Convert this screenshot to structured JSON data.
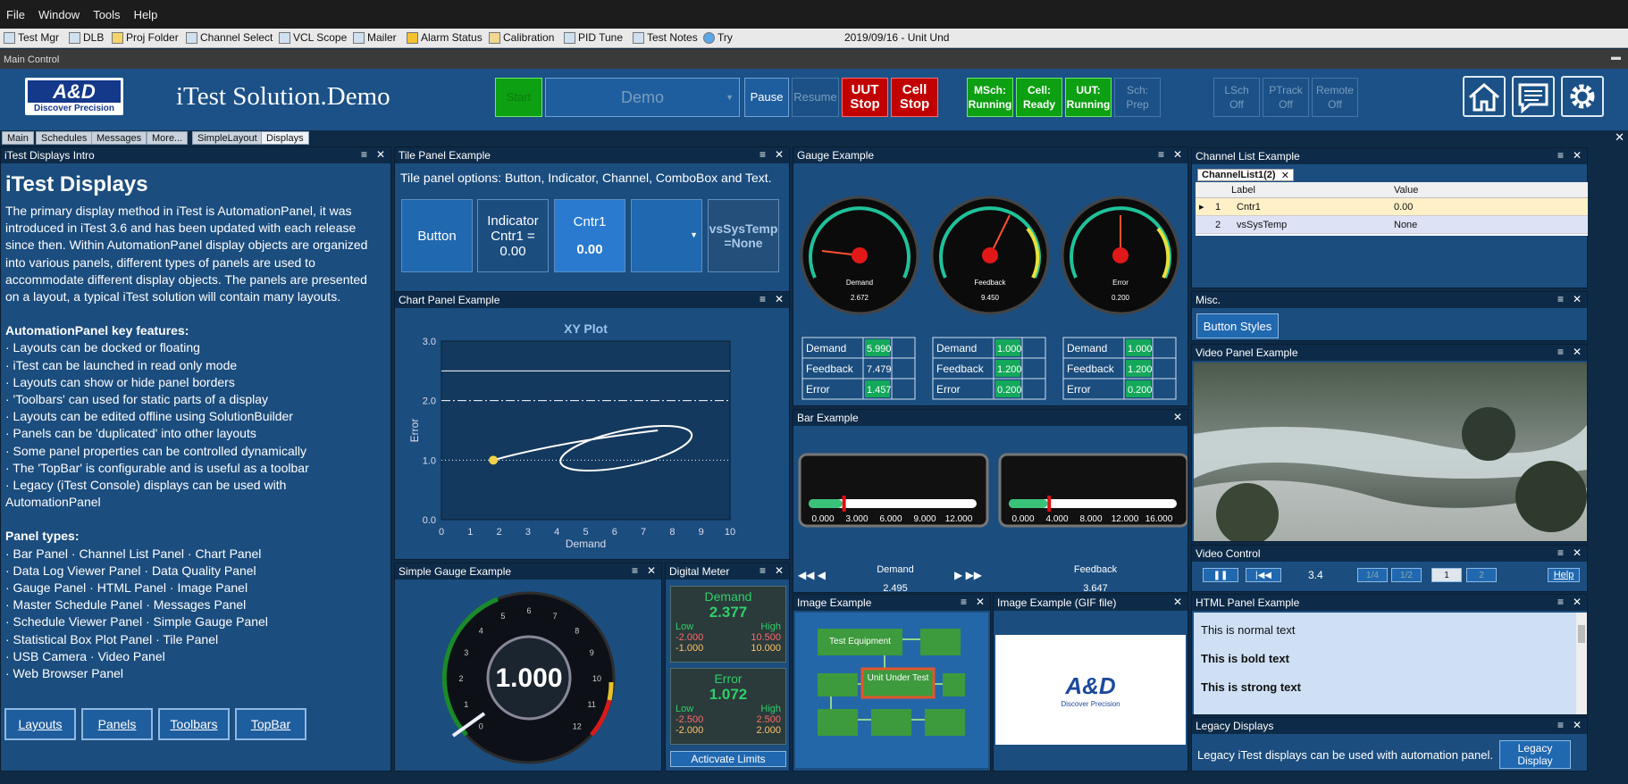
{
  "menu": [
    "File",
    "Window",
    "Tools",
    "Help"
  ],
  "toolbar": [
    "Test Mgr",
    "DLB",
    "Proj Folder",
    "Channel Select",
    "VCL Scope",
    "Mailer",
    "Alarm Status",
    "Calibration",
    "PID Tune",
    "Test Notes",
    "Try"
  ],
  "toolbar_status": "2019/09/16 - Unit Und",
  "main_control": "Main Control",
  "header": {
    "logo_text": "A&D",
    "logo_sub": "Discover Precision",
    "title": "iTest  Solution.Demo",
    "start": "Start",
    "demo": "Demo",
    "pause": "Pause",
    "resume": "Resume",
    "uut_stop_1": "UUT",
    "uut_stop_2": "Stop",
    "cell_stop_1": "Cell",
    "cell_stop_2": "Stop",
    "mstatus": [
      {
        "l1": "MSch:",
        "l2": "Running",
        "green": true
      },
      {
        "l1": "Cell:",
        "l2": "Ready",
        "green": true
      },
      {
        "l1": "UUT:",
        "l2": "Running",
        "green": true
      },
      {
        "l1": "Sch:",
        "l2": "Prep",
        "green": false
      }
    ],
    "ostatus": [
      {
        "l1": "LSch",
        "l2": "Off"
      },
      {
        "l1": "PTrack",
        "l2": "Off"
      },
      {
        "l1": "Remote",
        "l2": "Off"
      }
    ]
  },
  "tabs": [
    "Main",
    "Schedules",
    "Messages",
    "More...",
    "SimpleLayout",
    "Displays"
  ],
  "intro": {
    "title": "iTest Displays Intro",
    "heading": "iTest Displays",
    "lines": [
      "The primary display method in iTest is AutomationPanel, it was",
      "introduced in iTest 3.6 and has been updated with each release",
      "since then.  Within AutomationPanel display objects are organized",
      "into various panels, different types of panels are used to",
      "accommodate different display objects.  The panels are presented",
      "on a layout, a typical iTest solution will contain many layouts."
    ],
    "features_title": "AutomationPanel key features:",
    "features": [
      "· Layouts can be docked or floating",
      "· iTest can be launched in read only mode",
      "· Layouts can show or hide panel borders",
      "· 'Toolbars' can used for static parts of a display",
      "· Layouts can be edited offline using SolutionBuilder",
      "· Panels can be 'duplicated' into other layouts",
      "· Some panel properties can be controlled dynamically",
      "· The 'TopBar' is configurable and is useful as a toolbar",
      "· Legacy (iTest Console) displays can be used with",
      "AutomationPanel"
    ],
    "types_title": "Panel types:",
    "types": [
      "· Bar Panel · Channel List Panel · Chart Panel",
      "· Data Log Viewer Panel · Data Quality Panel",
      "· Gauge Panel · HTML Panel · Image Panel",
      "· Master Schedule Panel · Messages Panel",
      "· Schedule Viewer Panel · Simple Gauge Panel",
      "· Statistical Box Plot Panel · Tile Panel",
      "· USB Camera · Video Panel",
      "· Web Browser Panel"
    ],
    "buttons": [
      "Layouts",
      "Panels",
      "Toolbars",
      "TopBar"
    ]
  },
  "tile": {
    "title": "Tile Panel Example",
    "desc": "Tile panel options: Button, Indicator,  Channel, ComboBox and Text.",
    "button": "Button",
    "indicator": "Indicator\nCntr1 =\n0.00",
    "channel_name": "Cntr1",
    "channel_value": "0.00",
    "text": "vsSysTemp\n=None"
  },
  "chart": {
    "title": "Chart Panel Example"
  },
  "chart_data": {
    "type": "scatter",
    "title": "XY Plot",
    "xlabel": "Demand",
    "ylabel": "Error",
    "xlim": [
      0,
      10
    ],
    "ylim": [
      0,
      3
    ],
    "xticks": [
      "0",
      "1",
      "2",
      "3",
      "4",
      "5",
      "6",
      "7",
      "8",
      "9",
      "10"
    ],
    "yticks": [
      "0.0",
      "1.0",
      "2.0",
      "3.0"
    ],
    "hlines": [
      {
        "y": 2.5,
        "style": "solid"
      },
      {
        "y": 2.0,
        "style": "dashdot"
      },
      {
        "y": 1.0,
        "style": "dotted"
      }
    ],
    "trace_start": {
      "x": 1.8,
      "y": 1.0
    }
  },
  "gauge": {
    "title": "Gauge Example",
    "gauges": [
      {
        "label": "Demand",
        "value": "2.672",
        "rows": [
          [
            "Demand",
            "5.990"
          ],
          [
            "Feedback",
            "7.479"
          ],
          [
            "Error",
            "1.457"
          ]
        ]
      },
      {
        "label": "Feedback",
        "value": "9.450",
        "rows": [
          [
            "Demand",
            "1.000"
          ],
          [
            "Feedback",
            "1.200"
          ],
          [
            "Error",
            "0.200"
          ]
        ]
      },
      {
        "label": "Error",
        "value": "0.200",
        "rows": [
          [
            "Demand",
            "1.000"
          ],
          [
            "Feedback",
            "1.200"
          ],
          [
            "Error",
            "0.200"
          ]
        ]
      }
    ]
  },
  "bar": {
    "title": "Bar Example",
    "bars": [
      {
        "label": "Demand",
        "value": "2.495",
        "ticks": [
          "0.000",
          "3.000",
          "6.000",
          "9.000",
          "12.000"
        ],
        "fill": 0.2
      },
      {
        "label": "Feedback",
        "value": "3.647",
        "ticks": [
          "0.000",
          "4.000",
          "8.000",
          "12.000",
          "16.000"
        ],
        "fill": 0.23
      }
    ]
  },
  "channel_list": {
    "title": "Channel List Example",
    "tab": "ChannelList1(2)",
    "col_label": "Label",
    "col_value": "Value",
    "rows": [
      {
        "n": "1",
        "label": "Cntr1",
        "value": "0.00"
      },
      {
        "n": "2",
        "label": "vsSysTemp",
        "value": "None"
      }
    ]
  },
  "misc": {
    "title": "Misc.",
    "button": "Button Styles"
  },
  "video": {
    "title": "Video Panel Example"
  },
  "video_control": {
    "title": "Video Control",
    "value": "3.4",
    "speeds": [
      "1/4",
      "1/2",
      "1",
      "2"
    ],
    "help": "Help"
  },
  "simple_gauge": {
    "title": "Simple Gauge Example",
    "value": "1.000",
    "ticks": [
      "0",
      "1",
      "2",
      "3",
      "4",
      "5",
      "6",
      "7",
      "8",
      "9",
      "10",
      "11",
      "12"
    ]
  },
  "digital": {
    "title": "Digital Meter",
    "meters": [
      {
        "name": "Demand",
        "value": "2.377",
        "low": "Low",
        "high": "High",
        "lo1": "-2.000",
        "hi1": "10.500",
        "lo2": "-1.000",
        "hi2": "10.000"
      },
      {
        "name": "Error",
        "value": "1.072",
        "low": "Low",
        "high": "High",
        "lo1": "-2.500",
        "hi1": "2.500",
        "lo2": "-2.000",
        "hi2": "2.000"
      }
    ],
    "button": "Acticvate Limits"
  },
  "image": {
    "title": "Image Example",
    "boxes": [
      "Test Equipment",
      "Unit Under Test"
    ]
  },
  "gif": {
    "title": "Image Example (GIF file)",
    "logo": "A&D",
    "sub": "Discover Precision"
  },
  "html": {
    "title": "HTML Panel Example",
    "normal": "This is normal text",
    "bold": "This is bold text",
    "strong": "This is strong text"
  },
  "legacy": {
    "title": "Legacy Displays",
    "text": "Legacy iTest displays can be used with automation panel.",
    "button": "Legacy Display"
  }
}
